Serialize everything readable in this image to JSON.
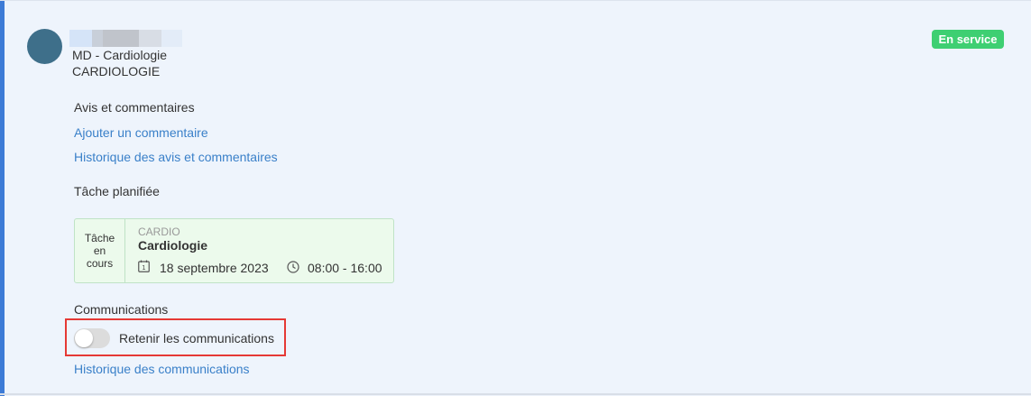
{
  "profile": {
    "role": "MD - Cardiologie",
    "department": "CARDIOLOGIE",
    "status_badge": "En service",
    "status_color": "#3ecf72",
    "avatar_color": "#3e6f8a"
  },
  "reviews": {
    "title": "Avis et commentaires",
    "add_comment_link": "Ajouter un commentaire",
    "history_link": "Historique des avis et commentaires"
  },
  "scheduled_task": {
    "title": "Tâche planifiée",
    "status": "Tâche en cours",
    "code": "CARDIO",
    "name": "Cardiologie",
    "date": "18 septembre 2023",
    "time": "08:00 - 16:00",
    "calendar_icon": "calendar-icon",
    "clock_icon": "clock-icon"
  },
  "communications": {
    "title": "Communications",
    "toggle_label": "Retenir les communications",
    "toggle_on": false,
    "history_link": "Historique des communications"
  },
  "colors": {
    "link": "#3a80c9",
    "accent": "#3d7bd6",
    "highlight": "#e53935"
  }
}
